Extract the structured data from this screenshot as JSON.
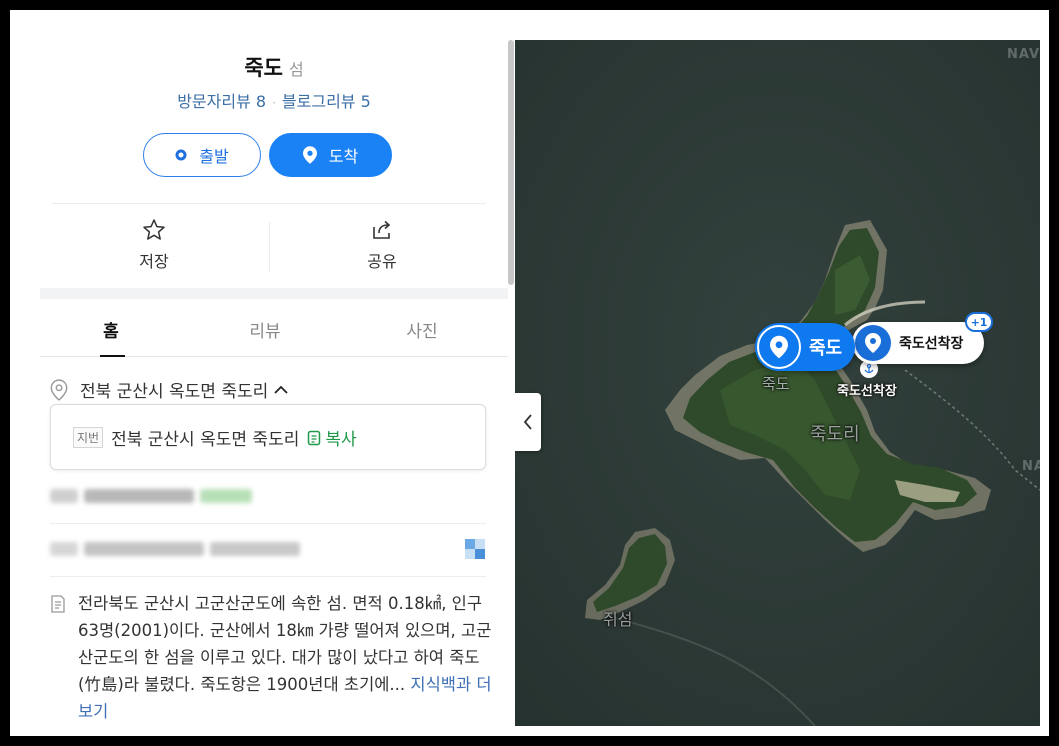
{
  "place": {
    "name": "죽도",
    "category": "섬",
    "visitor_reviews": "방문자리뷰 8",
    "review_dot": "·",
    "blog_reviews": "블로그리뷰 5"
  },
  "buttons": {
    "depart": "출발",
    "arrive": "도착"
  },
  "actions": {
    "save": "저장",
    "share": "공유"
  },
  "tabs": [
    {
      "label": "홈"
    },
    {
      "label": "리뷰"
    },
    {
      "label": "사진"
    }
  ],
  "address": {
    "road": "전북 군산시 옥도면 죽도리",
    "jibun_tag": "지번",
    "jibun": "전북 군산시 옥도면 죽도리",
    "copy": "복사"
  },
  "description": {
    "text": "전라북도 군산시 고군산군도에 속한 섬. 면적 0.18㎢, 인구 63명(2001)이다. 군산에서 18㎞ 가량 떨어져 있으며, 고군산군도의 한 섬을 이루고 있다. 대가 많이 났다고 하여 죽도(竹島)라 불렸다. 죽도항은 1900년대 초기에...",
    "more": "지식백과 더보기"
  },
  "map": {
    "watermark": "NAVER",
    "pin_main": "죽도",
    "pin_sub": "죽도선착장",
    "pin_sub_badge": "+1",
    "label_dock": "죽도선착장",
    "label_island": "죽도",
    "label_village": "죽도리",
    "label_other_island": "쥐섬"
  },
  "colors": {
    "accent": "#1a82f5",
    "link": "#3c6fa6",
    "copy_green": "#1f9a4a",
    "sea": "#2c3a36",
    "island": "#2f4a2a"
  }
}
